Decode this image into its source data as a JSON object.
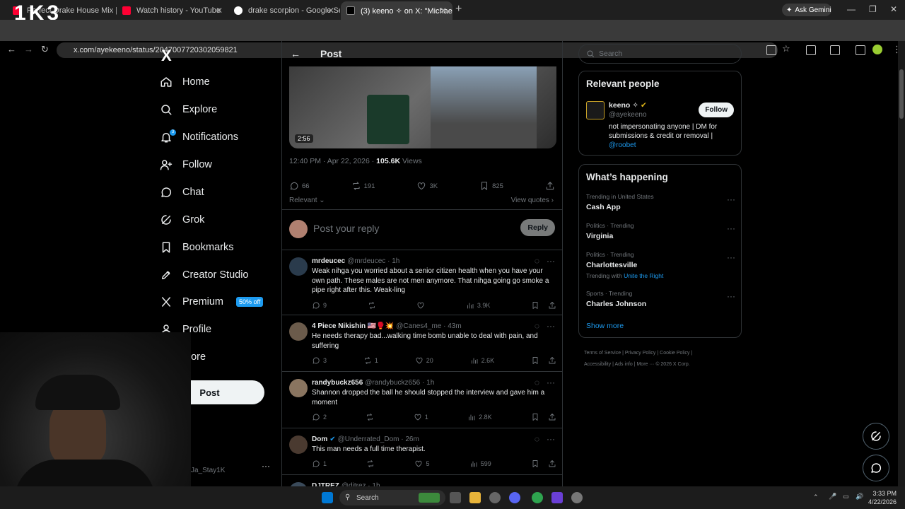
{
  "browser": {
    "tabs": [
      {
        "title": "Perfect Drake House Mix |",
        "color": "#ff0033"
      },
      {
        "title": "Watch history - YouTube",
        "color": "#ff0033"
      },
      {
        "title": "drake scorpion - Google Search",
        "color": "#4285f4"
      },
      {
        "title": "(3) keeno ✧ on X: \"Michael Bea",
        "color": "#ffffff"
      }
    ],
    "url": "x.com/ayekeeno/status/2047007720302059821",
    "gemini_label": "Ask Gemini",
    "overlay_text": "1K3"
  },
  "sidebar": {
    "logo": "X",
    "items": [
      {
        "label": "Home",
        "icon": "home-icon"
      },
      {
        "label": "Explore",
        "icon": "search-icon"
      },
      {
        "label": "Notifications",
        "icon": "bell-icon",
        "badge": "3"
      },
      {
        "label": "Follow",
        "icon": "person-plus-icon"
      },
      {
        "label": "Chat",
        "icon": "chat-bubble-icon"
      },
      {
        "label": "Grok",
        "icon": "grok-icon"
      },
      {
        "label": "Bookmarks",
        "icon": "bookmark-icon"
      },
      {
        "label": "Creator Studio",
        "icon": "rocket-icon"
      },
      {
        "label": "Premium",
        "icon": "x-icon",
        "badge": "50% off"
      },
      {
        "label": "Profile",
        "icon": "person-icon"
      },
      {
        "label": "More",
        "icon": "more-circle-icon"
      }
    ],
    "post_button": "Post",
    "account_handle": "Ja_Stay1K"
  },
  "main": {
    "header_title": "Post",
    "video_time": "2:56",
    "timestamp": "12:40 PM · Apr 22, 2026 ·",
    "views_count": "105.6K",
    "views_label": "Views",
    "stats": {
      "replies": "66",
      "reposts": "191",
      "likes": "3K",
      "bookmarks": "825"
    },
    "sort_label": "Relevant",
    "view_quotes": "View quotes",
    "reply_placeholder": "Post your reply",
    "reply_button": "Reply",
    "replies": [
      {
        "name": "mrdeucec",
        "handle": "@mrdeucec",
        "time": "· 1h",
        "text": "Weak nihga you worried about a senior citizen health when you have your own path. These males are not men anymore. That nihga going go smoke a pipe right after this. Weak-ling",
        "replies": "9",
        "reposts": "",
        "likes": "",
        "views": "3.9K",
        "avatar": "#2a3b4c"
      },
      {
        "name": "4 Piece Nikishin 🇺🇸🥊💥",
        "handle": "@Canes4_me",
        "time": "· 43m",
        "text": "He needs therapy bad...walking time bomb unable to deal with pain, and suffering",
        "replies": "3",
        "reposts": "1",
        "likes": "20",
        "views": "2.6K",
        "avatar": "#6b5b4b"
      },
      {
        "name": "randybuckz656",
        "handle": "@randybuckz656",
        "time": "· 1h",
        "text": "Shannon dropped the ball he should stopped the interview and gave him a moment",
        "replies": "2",
        "reposts": "",
        "likes": "1",
        "views": "2.8K",
        "avatar": "#8a7560"
      },
      {
        "name": "Dom",
        "handle": "@Underrated_Dom",
        "time": "· 26m",
        "text": "This man needs a full time therapist.",
        "replies": "1",
        "reposts": "",
        "likes": "5",
        "views": "599",
        "avatar": "#4a3a30"
      },
      {
        "name": "DJTREZ",
        "handle": "@djtrez",
        "time": "· 1h",
        "text": "",
        "replies": "",
        "reposts": "",
        "likes": "",
        "views": "",
        "avatar": "#3a4a5a"
      }
    ]
  },
  "right": {
    "search_placeholder": "Search",
    "relevant_title": "Relevant people",
    "person": {
      "name": "keeno ✧",
      "handle": "@ayekeeno",
      "bio": "not impersonating anyone | DM for submissions & credit or removal |",
      "bio_link": "@roobet",
      "follow": "Follow"
    },
    "happening_title": "What’s happening",
    "trends": [
      {
        "context": "Trending in United States",
        "name": "Cash App",
        "extra": ""
      },
      {
        "context": "Politics · Trending",
        "name": "Virginia",
        "extra": ""
      },
      {
        "context": "Politics · Trending",
        "name": "Charlottesville",
        "extra": "Trending with",
        "extra_link": "Unite the Right"
      },
      {
        "context": "Sports · Trending",
        "name": "Charles Johnson",
        "extra": ""
      }
    ],
    "show_more": "Show more",
    "footer": [
      "Terms of Service",
      "Privacy Policy",
      "Cookie Policy",
      "Accessibility",
      "Ads info",
      "More ···",
      "© 2026 X Corp."
    ]
  },
  "taskbar": {
    "search": "Search",
    "time": "3:33 PM",
    "date": "4/22/2026"
  }
}
